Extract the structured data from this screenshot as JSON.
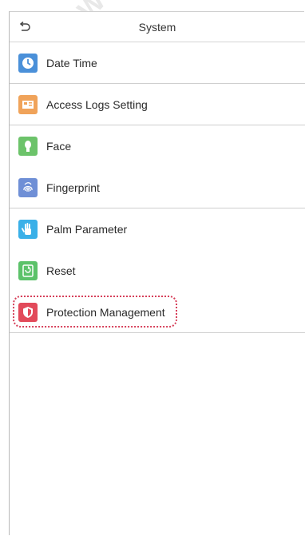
{
  "header": {
    "title": "System",
    "back_icon": "back-arrow-icon"
  },
  "menu": {
    "items": [
      {
        "label": "Date Time",
        "icon": "clock-icon",
        "icon_color": "#4a90d9"
      },
      {
        "label": "Access Logs Setting",
        "icon": "logs-icon",
        "icon_color": "#f0a35a"
      },
      {
        "label": "Face",
        "icon": "face-icon",
        "icon_color": "#6cc36a"
      },
      {
        "label": "Fingerprint",
        "icon": "fingerprint-icon",
        "icon_color": "#6f8fd6"
      },
      {
        "label": "Palm Parameter",
        "icon": "palm-icon",
        "icon_color": "#3ab0e8"
      },
      {
        "label": "Reset",
        "icon": "reset-icon",
        "icon_color": "#5cc26a"
      },
      {
        "label": "Protection Management",
        "icon": "shield-icon",
        "icon_color": "#e24a5a"
      }
    ],
    "highlighted": "Protection Management"
  },
  "watermark": "WWW"
}
